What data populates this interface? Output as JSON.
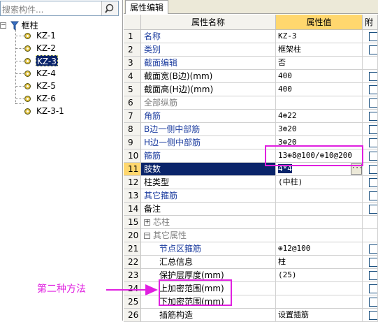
{
  "search": {
    "placeholder_visible": "搜索构件..."
  },
  "tree": {
    "root": "框柱",
    "items": [
      "KZ-1",
      "KZ-2",
      "KZ-3",
      "KZ-4",
      "KZ-5",
      "KZ-6",
      "KZ-3-1"
    ],
    "selected": "KZ-3"
  },
  "panel": {
    "tab": "属性编辑"
  },
  "grid": {
    "headers": {
      "name": "属性名称",
      "value": "属性值",
      "extra": "附加"
    },
    "rows": [
      {
        "n": "1",
        "name": "名称",
        "value": "KZ-3"
      },
      {
        "n": "2",
        "name": "类别",
        "value": "框架柱"
      },
      {
        "n": "3",
        "name": "截面编辑",
        "value": "否"
      },
      {
        "n": "4",
        "name": "截面宽(B边)(mm)",
        "value": "400"
      },
      {
        "n": "5",
        "name": "截面高(H边)(mm)",
        "value": "400"
      },
      {
        "n": "6",
        "name": "全部纵筋",
        "value": ""
      },
      {
        "n": "7",
        "name": "角筋",
        "value": "4⊕22"
      },
      {
        "n": "8",
        "name": "B边一侧中部筋",
        "value": "3⊕20"
      },
      {
        "n": "9",
        "name": "H边一侧中部筋",
        "value": "3⊕20"
      },
      {
        "n": "10",
        "name": "箍筋",
        "value": "13⊕8@100/⊕10@200"
      },
      {
        "n": "11",
        "name": "肢数",
        "value": "4*4"
      },
      {
        "n": "12",
        "name": "柱类型",
        "value": "(中柱)"
      },
      {
        "n": "13",
        "name": "其它箍筋",
        "value": ""
      },
      {
        "n": "14",
        "name": "备注",
        "value": ""
      },
      {
        "n": "15",
        "name": "芯柱",
        "value": ""
      },
      {
        "n": "20",
        "name": "其它属性",
        "value": ""
      },
      {
        "n": "21",
        "name": "节点区箍筋",
        "value": "⊕12@100"
      },
      {
        "n": "22",
        "name": "汇总信息",
        "value": "柱"
      },
      {
        "n": "23",
        "name": "保护层厚度(mm)",
        "value": "(25)"
      },
      {
        "n": "24",
        "name": "上加密范围(mm)",
        "value": ""
      },
      {
        "n": "25",
        "name": "下加密范围(mm)",
        "value": ""
      },
      {
        "n": "26",
        "name": "插筋构造",
        "value": "设置插筋"
      }
    ]
  },
  "annotation": {
    "label": "第二种方法"
  },
  "colors": {
    "highlight": "#e020e0",
    "selection": "#0a246a",
    "blue_text": "#1f3fa0"
  }
}
